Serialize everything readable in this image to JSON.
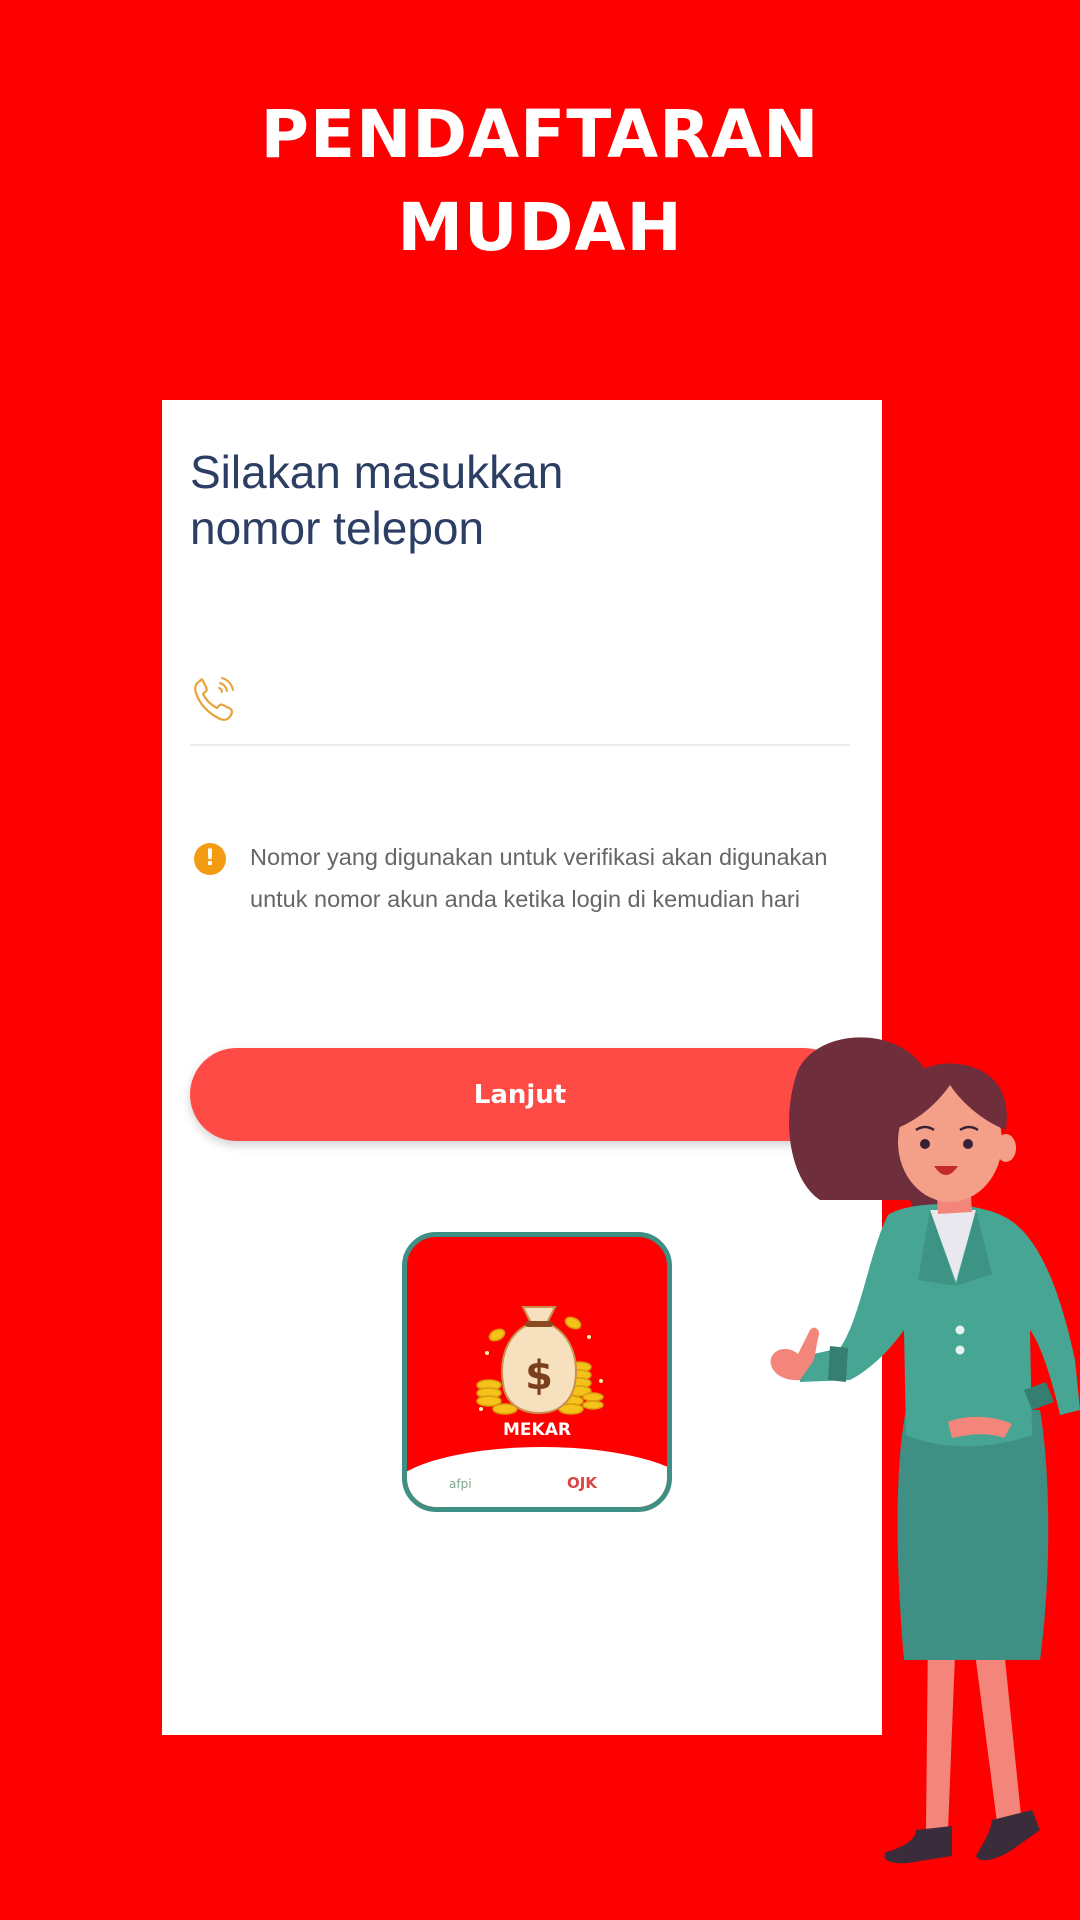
{
  "banner": {
    "title_line1": "PENDAFTARAN",
    "title_line2": "MUDAH"
  },
  "form": {
    "title_line1": "Silakan masukkan",
    "title_line2": "nomor telepon",
    "phone_placeholder": "",
    "phone_value": "",
    "phone_icon": "phone-icon",
    "notice_icon": "info-exclamation-icon",
    "notice_text": "Nomor yang digunakan untuk verifikasi akan digunakan untuk nomor akun anda ketika login di kemudian hari",
    "submit_label": "Lanjut"
  },
  "app_logo": {
    "name": "MEKAR",
    "left_partner": "afpi",
    "right_partner": "OJK"
  },
  "colors": {
    "background": "#ff0000",
    "button": "#ff4b45",
    "title_text": "#2c3e64",
    "icon_accent": "#f39c12",
    "logo_border": "#3e8f84"
  }
}
